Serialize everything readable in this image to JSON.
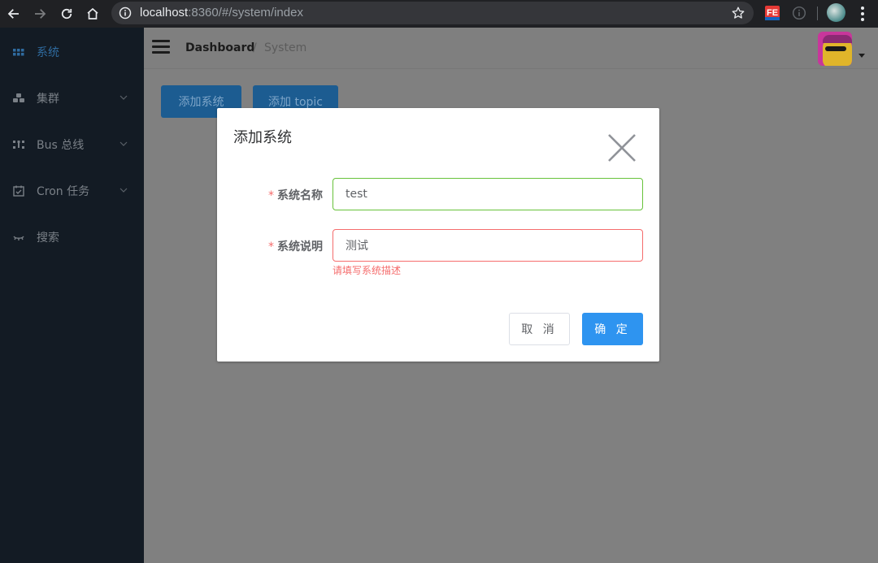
{
  "browser": {
    "url_host": "localhost",
    "url_rest": ":8360/#/system/index"
  },
  "sidebar": {
    "items": [
      {
        "label": "系统",
        "icon": "grid-icon",
        "active": true
      },
      {
        "label": "集群",
        "icon": "cluster-icon",
        "has_children": true
      },
      {
        "label": "Bus 总线",
        "icon": "bus-icon",
        "has_children": true
      },
      {
        "label": "Cron 任务",
        "icon": "calendar-icon",
        "has_children": true
      },
      {
        "label": "搜索",
        "icon": "search-icon"
      }
    ]
  },
  "navbar": {
    "breadcrumb_home": "Dashboard",
    "breadcrumb_separator": "/",
    "breadcrumb_current": "System"
  },
  "toolbar": {
    "add_system_label": "添加系统",
    "add_topic_label": "添加 topic"
  },
  "dialog": {
    "title": "添加系统",
    "fields": [
      {
        "label": "系统名称",
        "value": "test",
        "state": "success",
        "required": true
      },
      {
        "label": "系统说明",
        "value": "测试",
        "state": "error",
        "required": true,
        "error": "请填写系统描述"
      }
    ],
    "required_mark": "*",
    "cancel_label": "取 消",
    "confirm_label": "确 定"
  },
  "colors": {
    "primary": "#409eff",
    "success": "#67c23a",
    "danger": "#f56c6c",
    "sidebar_bg": "#131b24"
  }
}
